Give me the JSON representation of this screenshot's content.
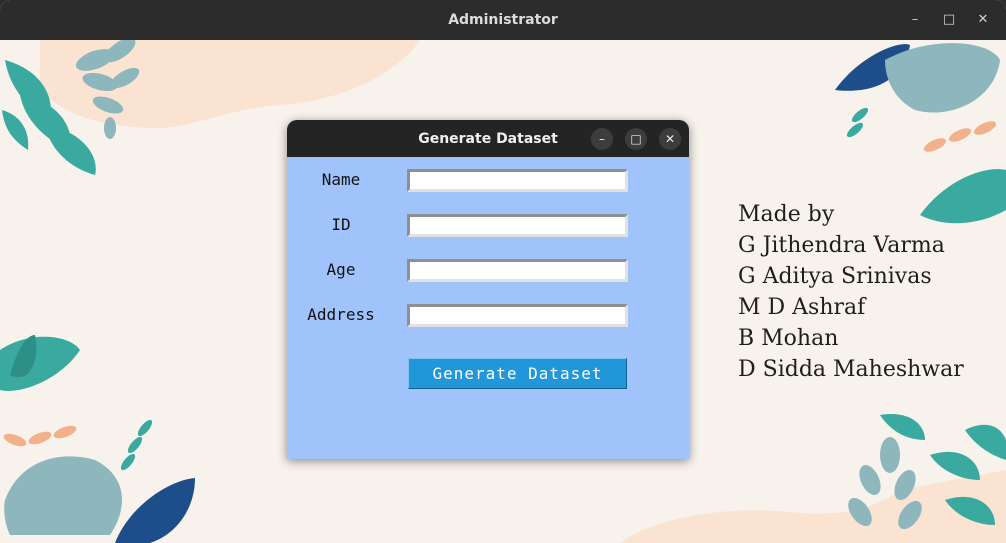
{
  "window": {
    "title": "Administrator",
    "minimize_icon": "minimize-icon",
    "maximize_icon": "maximize-icon",
    "close_icon": "close-icon"
  },
  "credits": {
    "heading": "Made by",
    "names": [
      "G Jithendra Varma",
      "G Aditya Srinivas",
      "M D Ashraf",
      "B Mohan",
      "D Sidda Maheshwar"
    ]
  },
  "dialog": {
    "title": "Generate Dataset",
    "fields": [
      {
        "label": "Name",
        "value": ""
      },
      {
        "label": "ID",
        "value": ""
      },
      {
        "label": "Age",
        "value": ""
      },
      {
        "label": "Address",
        "value": ""
      }
    ],
    "button_label": "Generate Dataset",
    "minimize_glyph": "–",
    "maximize_glyph": "□",
    "close_glyph": "✕"
  },
  "colors": {
    "dialog_bg": "#a1c3fc",
    "button_bg": "#2196d8",
    "titlebar_bg": "#2c2c2c",
    "background": "#f7f2ec",
    "leaf_teal": "#3aa99f",
    "leaf_navy": "#1d4e89",
    "leaf_peach": "#f1b18b"
  }
}
